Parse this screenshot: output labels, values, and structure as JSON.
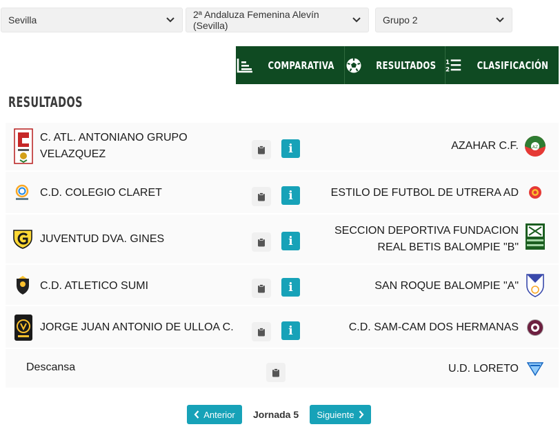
{
  "filters": {
    "province": "Sevilla",
    "competition": "2ª Andaluza Femenina Alevín (Sevilla)",
    "group": "Grupo 2"
  },
  "tabs": [
    {
      "label": "COMPARATIVA",
      "icon": "chart-icon"
    },
    {
      "label": "RESULTADOS",
      "icon": "soccer-ball-icon"
    },
    {
      "label": "CLASIFICACIÓN",
      "icon": "ranking-list-icon"
    }
  ],
  "section_title": "RESULTADOS",
  "matches": [
    {
      "home": "C. ATL. ANTONIANO GRUPO VELAZQUEZ",
      "away": "AZAHAR C.F."
    },
    {
      "home": "C.D. COLEGIO CLARET",
      "away": "ESTILO DE FUTBOL DE UTRERA AD"
    },
    {
      "home": "JUVENTUD DVA. GINES",
      "away": "SECCION DEPORTIVA FUNDACION REAL BETIS BALOMPIE \"B\""
    },
    {
      "home": "C.D. ATLETICO SUMI",
      "away": "SAN ROQUE BALOMPIE \"A\""
    },
    {
      "home": "JORGE JUAN ANTONIO DE ULLOA C.",
      "away": "C.D. SAM-CAM DOS HERMANAS"
    },
    {
      "home": "Descansa",
      "away": "U.D. LORETO"
    }
  ],
  "info_label": "i",
  "pager": {
    "prev": "Anterior",
    "current": "Jornada 5",
    "next": "Siguiente"
  },
  "colors": {
    "tab_bg": "#0f4a22",
    "accent": "#17a2b8",
    "row_bg": "#fafafa"
  }
}
